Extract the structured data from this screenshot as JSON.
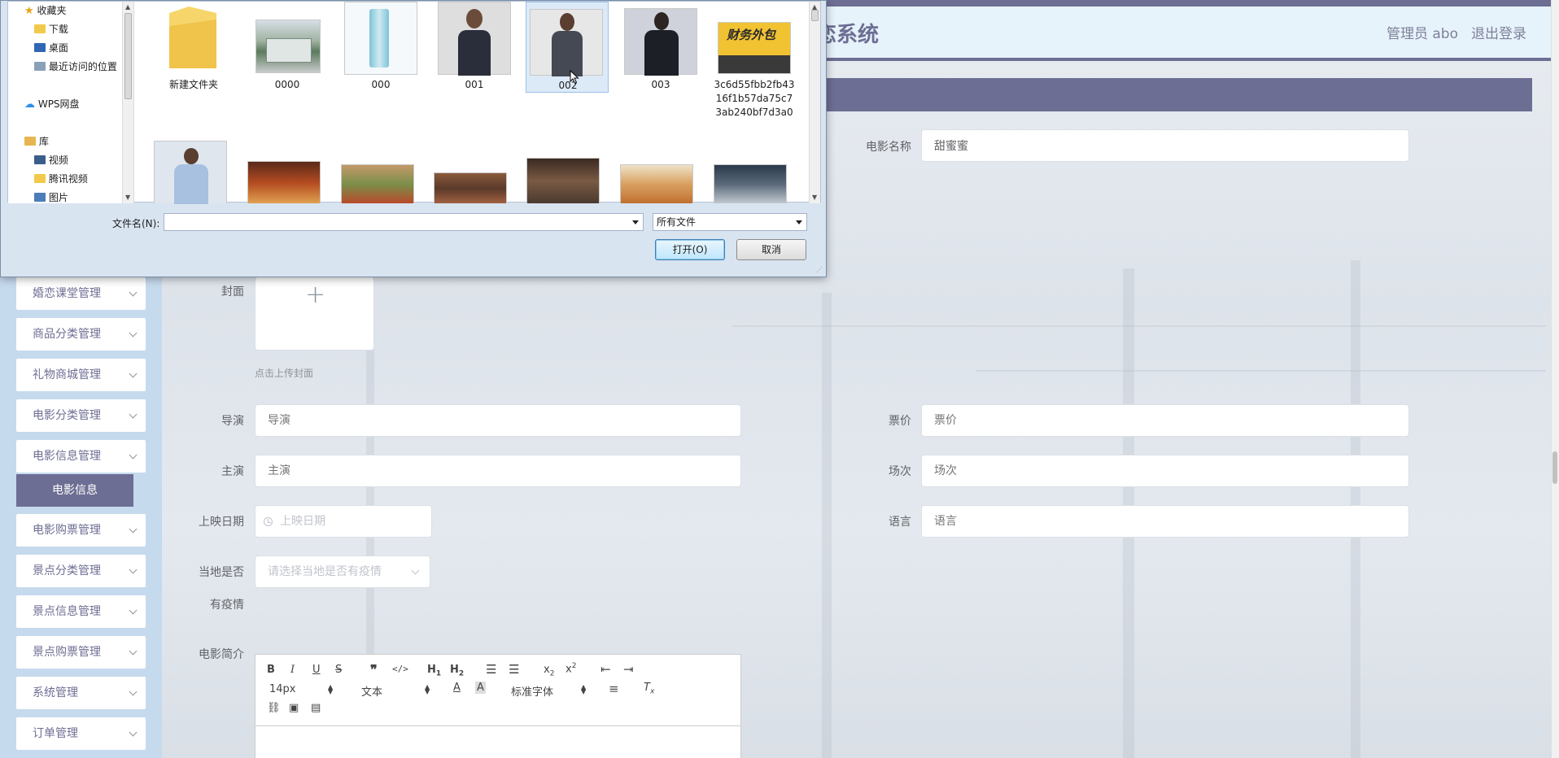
{
  "header": {
    "title": "婚恋系统",
    "title_visible": "恋系统",
    "user": "管理员 abo",
    "logout": "退出登录"
  },
  "sidebar": {
    "items": [
      {
        "label": "婚恋课堂管理"
      },
      {
        "label": "商品分类管理"
      },
      {
        "label": "礼物商城管理"
      },
      {
        "label": "电影分类管理"
      },
      {
        "label": "电影信息管理"
      },
      {
        "label": "电影购票管理"
      },
      {
        "label": "景点分类管理"
      },
      {
        "label": "景点信息管理"
      },
      {
        "label": "景点购票管理"
      },
      {
        "label": "系统管理"
      },
      {
        "label": "订单管理"
      }
    ],
    "active_sub": "电影信息"
  },
  "form": {
    "movie_name": {
      "label": "电影名称",
      "value": "甜蜜蜜"
    },
    "cover": {
      "label": "封面",
      "hint": "点击上传封面"
    },
    "director": {
      "label": "导演",
      "placeholder": "导演"
    },
    "price": {
      "label": "票价",
      "placeholder": "票价"
    },
    "actor": {
      "label": "主演",
      "placeholder": "主演"
    },
    "session": {
      "label": "场次",
      "placeholder": "场次"
    },
    "release_date": {
      "label": "上映日期",
      "placeholder": "上映日期"
    },
    "language": {
      "label": "语言",
      "placeholder": "语言"
    },
    "epidemic": {
      "label_line1": "当地是否",
      "label_line2": "有疫情",
      "placeholder": "请选择当地是否有疫情"
    },
    "intro": {
      "label": "电影简介"
    }
  },
  "editor": {
    "font_size": "14px",
    "header_select": "文本",
    "font_family": "标准字体"
  },
  "dialog": {
    "nav": {
      "favorites": "收藏夹",
      "downloads": "下载",
      "desktop": "桌面",
      "recent": "最近访问的位置",
      "wps": "WPS网盘",
      "library": "库",
      "videos": "视频",
      "tencent_video": "腾讯视频",
      "pictures": "图片"
    },
    "files": [
      {
        "name": "新建文件夹",
        "kind": "folder"
      },
      {
        "name": "0000",
        "kind": "bus"
      },
      {
        "name": "000",
        "kind": "bottle"
      },
      {
        "name": "001",
        "kind": "person-f"
      },
      {
        "name": "002",
        "kind": "person-f2",
        "selected": true
      },
      {
        "name": "003",
        "kind": "person-m"
      },
      {
        "name": "3c6d55fbb2fb4316f1b57da75c73ab240bf7d3a0",
        "kind": "poster",
        "poster_text": "财务外包"
      }
    ],
    "filename_label": "文件名(N):",
    "filename_value": "",
    "filetype": "所有文件",
    "open_button": "打开(O)",
    "cancel_button": "取消"
  },
  "colors": {
    "accent": "#6d6e93",
    "sidebar_bg": "#c6daee",
    "header_bg": "#e6f3fb"
  }
}
